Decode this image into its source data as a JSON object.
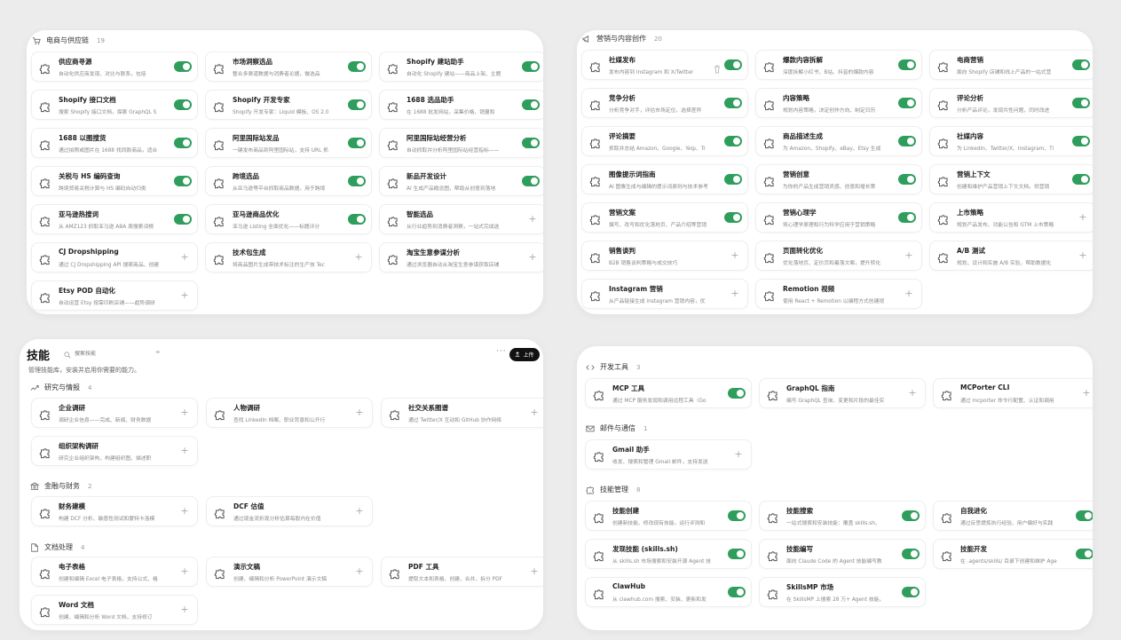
{
  "ecommerce": {
    "title": "电商与供应链",
    "count": "19",
    "items": [
      {
        "title": "供应商寻源",
        "desc": "自动化供应商发现、对比与联系，包括",
        "state": "on"
      },
      {
        "title": "市场洞察选品",
        "desc": "整合多渠道数据与消费者论据，做选品",
        "state": "on"
      },
      {
        "title": "Shopify 建站助手",
        "desc": "自动化 Shopify 建站——商品上架、主题",
        "state": "on"
      },
      {
        "title": "Shopify 接口文档",
        "desc": "搜索 Shopify 接口文档，探索 GraphQL S",
        "state": "on"
      },
      {
        "title": "Shopify 开发专家",
        "desc": "Shopify 开发专家：Liquid 模板、OS 2.0",
        "state": "on"
      },
      {
        "title": "1688 选品助手",
        "desc": "在 1688 批发网站，采集价格、销量和",
        "state": "on"
      },
      {
        "title": "1688 以图搜货",
        "desc": "通过拍照或图片在 1688 找同款商品，适合",
        "state": "on"
      },
      {
        "title": "阿里国际站发品",
        "desc": "一键发布商品到阿里国际站，支持 URL 抓",
        "state": "on"
      },
      {
        "title": "阿里国际站经营分析",
        "desc": "自动抓取并分析阿里国际站经营指标——",
        "state": "on"
      },
      {
        "title": "关税与 HS 编码查询",
        "desc": "跨境贸易关税计算与 HS 编码自动归类",
        "state": "on"
      },
      {
        "title": "跨境选品",
        "desc": "从亚马逊等平台抓取商品数据，用于跨境",
        "state": "on"
      },
      {
        "title": "新品开发设计",
        "desc": "AI 生成产品概念图，帮助从创意到落地",
        "state": "on"
      },
      {
        "title": "亚马逊热搜词",
        "desc": "从 AMZ123 抓取亚马逊 ABA 周搜索词榜",
        "state": "on"
      },
      {
        "title": "亚马逊商品优化",
        "desc": "亚马逊 Listing 全面优化——标题评分",
        "state": "on"
      },
      {
        "title": "智能选品",
        "desc": "从行业趋势到消费者洞察，一站式完成选",
        "state": "off"
      },
      {
        "title": "CJ Dropshipping",
        "desc": "通过 CJ Dropshipping API 搜索商品、创建",
        "state": "off"
      },
      {
        "title": "技术包生成",
        "desc": "将商品图片生成带技术标注的生产技 Tec",
        "state": "off"
      },
      {
        "title": "淘宝生意参谋分析",
        "desc": "通过浏览器自动从淘宝生意参谋获取店铺",
        "state": "off"
      },
      {
        "title": "Etsy POD 自动化",
        "desc": "自动运营 Etsy 按需印刷店铺——趋势调研",
        "state": "off"
      }
    ]
  },
  "marketing": {
    "title": "营销与内容创作",
    "count": "20",
    "items": [
      {
        "title": "社媒发布",
        "desc": "发布内容到 Instagram 和 X/Twitter",
        "state": "on",
        "trash": true
      },
      {
        "title": "爆款内容拆解",
        "desc": "深度拆解小红书、B站、抖音的爆款内容",
        "state": "on"
      },
      {
        "title": "电商营销",
        "desc": "面向 Shopify 店铺和线上产品的一站式营",
        "state": "on"
      },
      {
        "title": "竞争分析",
        "desc": "分析竞争对手，评估市场定位、选择差异",
        "state": "on"
      },
      {
        "title": "内容策略",
        "desc": "规划内容策略，决定创作方向、制定日历",
        "state": "on"
      },
      {
        "title": "评论分析",
        "desc": "分析产品评论，发现共性问题，同时改进",
        "state": "on"
      },
      {
        "title": "评论摘要",
        "desc": "抓取并总结 Amazon、Google、Yelp、Tr",
        "state": "on"
      },
      {
        "title": "商品描述生成",
        "desc": "为 Amazon、Shopify、eBay、Etsy 生成",
        "state": "on"
      },
      {
        "title": "社媒内容",
        "desc": "为 LinkedIn、Twitter/X、Instagram、Ti",
        "state": "on"
      },
      {
        "title": "图像提示词指南",
        "desc": "AI 图像生成与编辑的提示词原则与技术参考",
        "state": "on"
      },
      {
        "title": "营销创意",
        "desc": "为你的产品生成营销灵感、创意和增长策",
        "state": "on"
      },
      {
        "title": "营销上下文",
        "desc": "创建和维护产品营销上下文文档，供营销",
        "state": "on"
      },
      {
        "title": "营销文案",
        "desc": "撰写、改写和优化落地页、产品介绍等营销",
        "state": "on"
      },
      {
        "title": "营销心理学",
        "desc": "将心理学原理和行为科学应用于营销策略",
        "state": "on"
      },
      {
        "title": "上市策略",
        "desc": "规划产品发布、功能公告和 GTM 上市策略",
        "state": "off"
      },
      {
        "title": "销售谈判",
        "desc": "B2B 销售谈判策略与成交技巧",
        "state": "off"
      },
      {
        "title": "页面转化优化",
        "desc": "优化落地页、定价页和着落文案，提升转化",
        "state": "off"
      },
      {
        "title": "A/B 测试",
        "desc": "规划、设计和实施 A/B 实验，帮助数据化",
        "state": "off"
      },
      {
        "title": "Instagram 营销",
        "desc": "从产品链接生成 Instagram 营销内容，优",
        "state": "off"
      },
      {
        "title": "Remotion 视频",
        "desc": "使用 React + Remotion 以编程方式创建视",
        "state": "off"
      }
    ]
  },
  "skills_page": {
    "title": "技能",
    "search_placeholder": "搜索技能",
    "upload_label": "上传",
    "subtitle": "管理技能库，安装并启用你需要的能力。",
    "research": {
      "title": "研究与情报",
      "count": "4",
      "items": [
        {
          "title": "企业调研",
          "desc": "调研企业信息——完成、新闻、财务数据",
          "state": "off"
        },
        {
          "title": "人物调研",
          "desc": "查找 LinkedIn 档案、职业背景和公开行",
          "state": "off"
        },
        {
          "title": "社交关系图谱",
          "desc": "通过 Twitter/X 互动和 GitHub 协作网络",
          "state": "off"
        },
        {
          "title": "组织架构调研",
          "desc": "研究企业组织架构，构建组织图、描述职",
          "state": "off"
        }
      ]
    },
    "finance": {
      "title": "金融与财务",
      "count": "2",
      "items": [
        {
          "title": "财务建模",
          "desc": "构建 DCF 分析、敏感性测试和蒙特卡洛模",
          "state": "off"
        },
        {
          "title": "DCF 估值",
          "desc": "通过现金流折现分析估算每股内在价值",
          "state": "off"
        }
      ]
    },
    "docs": {
      "title": "文档处理",
      "count": "4",
      "items": [
        {
          "title": "电子表格",
          "desc": "创建和编辑 Excel 电子表格，支持公式、格",
          "state": "off"
        },
        {
          "title": "演示文稿",
          "desc": "创建、编辑和分析 PowerPoint 演示文稿",
          "state": "off"
        },
        {
          "title": "PDF 工具",
          "desc": "提取文本和表格、创建、合并、拆分 PDF",
          "state": "off"
        },
        {
          "title": "Word 文档",
          "desc": "创建、编辑和分析 Word 文档，支持修订",
          "state": "off"
        }
      ]
    }
  },
  "devtools": {
    "title": "开发工具",
    "count": "3",
    "items": [
      {
        "title": "MCP 工具",
        "desc": "通过 MCP 服务发现和调用远程工具（Go",
        "state": "on"
      },
      {
        "title": "GraphQL 指南",
        "desc": "编写 GraphQL 查询、变更和片段的最佳实",
        "state": "off"
      },
      {
        "title": "MCPorter CLI",
        "desc": "通过 mcporter 命令行配置、认证和调用",
        "state": "off"
      }
    ]
  },
  "mail": {
    "title": "邮件与通信",
    "count": "1",
    "items": [
      {
        "title": "Gmail 助手",
        "desc": "收发、搜索和管理 Gmail 邮件，支持发送",
        "state": "off"
      }
    ]
  },
  "skillmgmt": {
    "title": "技能管理",
    "count": "8",
    "items": [
      {
        "title": "技能创建",
        "desc": "创建新技能、修改现有技能，运行评测和",
        "state": "on"
      },
      {
        "title": "技能搜索",
        "desc": "一站式搜索和安装技能：覆盖 skills.sh、",
        "state": "on"
      },
      {
        "title": "自我进化",
        "desc": "通过反思提炼执行经验、用户偏好与实践",
        "state": "on"
      },
      {
        "title": "发现技能 (skills.sh)",
        "desc": "从 skills.sh 市场搜索和安装开源 Agent 技",
        "state": "on"
      },
      {
        "title": "技能编写",
        "desc": "面向 Claude Code 的 Agent 技能编写教",
        "state": "on"
      },
      {
        "title": "技能开发",
        "desc": "在 .agents/skills/ 目录下创建和维护 Age",
        "state": "on"
      },
      {
        "title": "ClawHub",
        "desc": "从 clawhub.com 搜索、安装、更新和发",
        "state": "on"
      },
      {
        "title": "SkillsMP 市场",
        "desc": "在 SkillsMP 上搜索 28 万+ Agent 技能，",
        "state": "on"
      }
    ]
  },
  "colors": {
    "toggle_on": "#2f9e5c",
    "background": "#ececec",
    "panel": "#ffffff",
    "upload_button": "#111111"
  }
}
